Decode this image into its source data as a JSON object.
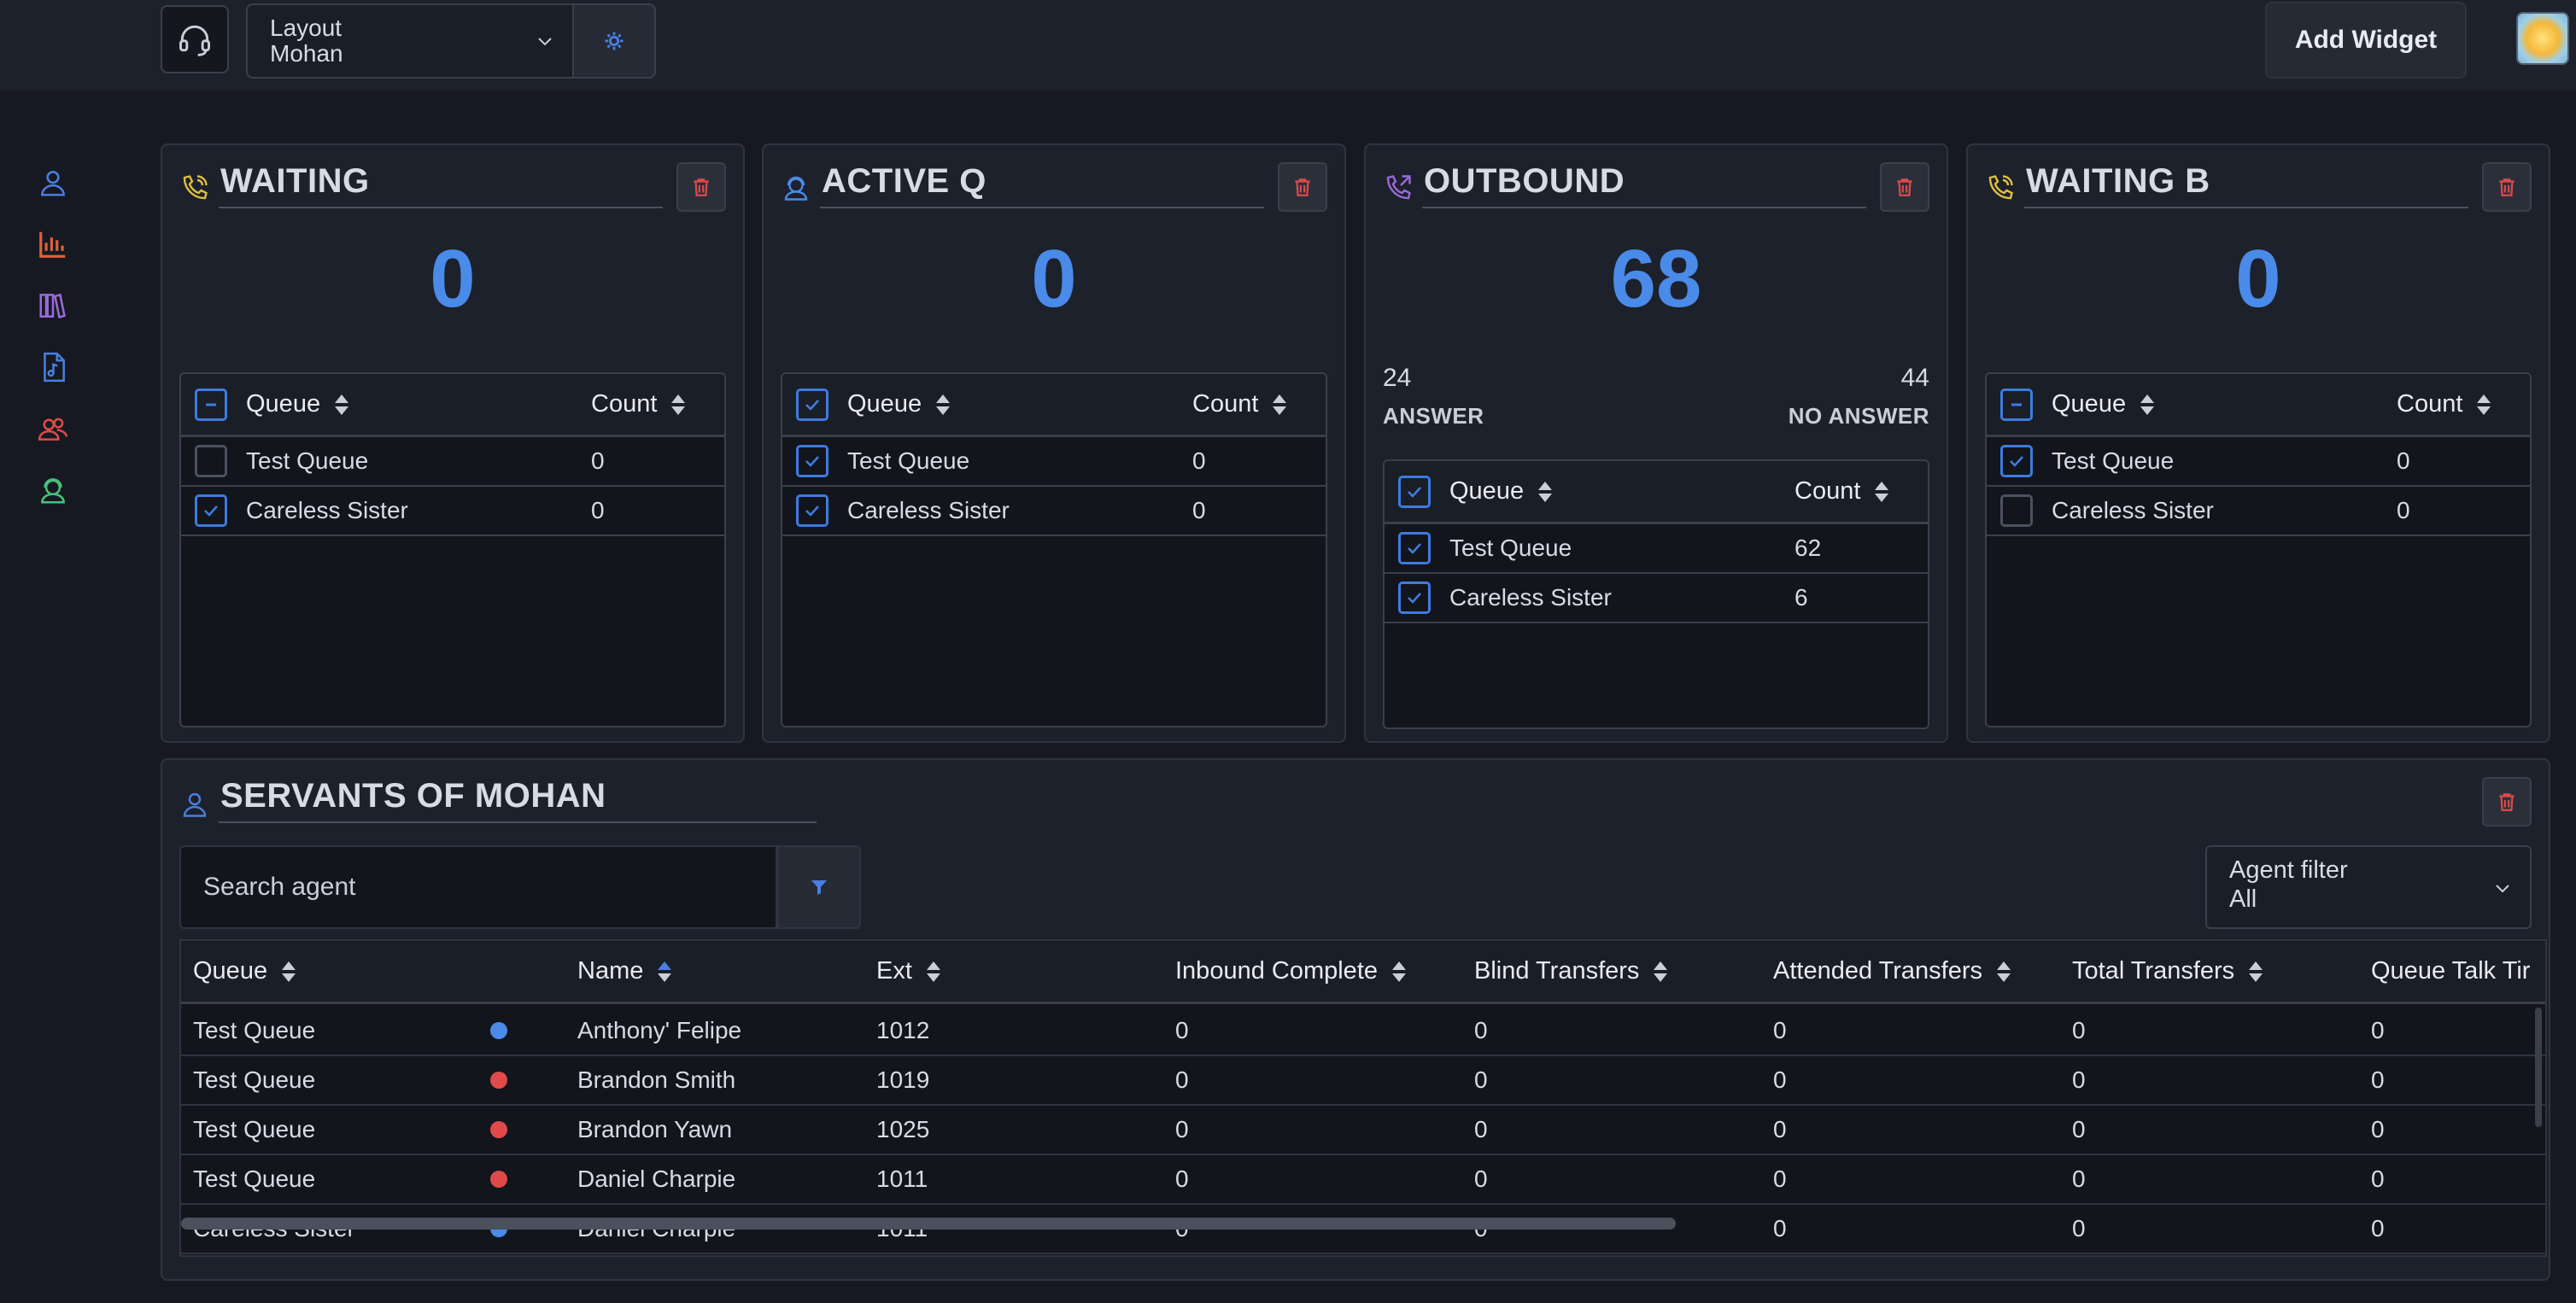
{
  "topbar": {
    "layout_label": "Layout",
    "layout_value": "Mohan",
    "add_widget_label": "Add Widget"
  },
  "sidebar": {
    "items": [
      {
        "icon": "user-icon",
        "color": "#4a7fe0"
      },
      {
        "icon": "bar-chart-icon",
        "color": "#e0603a"
      },
      {
        "icon": "books-icon",
        "color": "#9a6ad8"
      },
      {
        "icon": "music-file-icon",
        "color": "#4a7fe0"
      },
      {
        "icon": "users-icon",
        "color": "#e04a4a"
      },
      {
        "icon": "agent-headset-icon",
        "color": "#4ac07a"
      }
    ]
  },
  "widgets": [
    {
      "title": "WAITING",
      "icon": "phone-ringing-icon",
      "icon_color": "#e0c040",
      "value": "0",
      "table": {
        "col_queue": "Queue",
        "col_count": "Count",
        "rows": [
          {
            "queue": "Test Queue",
            "count": "0",
            "checked": false
          },
          {
            "queue": "Careless Sister",
            "count": "0",
            "checked": true
          }
        ]
      }
    },
    {
      "title": "ACTIVE Q",
      "icon": "agent-headset-icon",
      "icon_color": "#4a8ae8",
      "value": "0",
      "table": {
        "col_queue": "Queue",
        "col_count": "Count",
        "rows": [
          {
            "queue": "Test Queue",
            "count": "0",
            "checked": true
          },
          {
            "queue": "Careless Sister",
            "count": "0",
            "checked": true
          }
        ]
      }
    },
    {
      "title": "OUTBOUND",
      "icon": "phone-outgoing-icon",
      "icon_color": "#9a6ad8",
      "value": "68",
      "answer_value": "24",
      "answer_label": "ANSWER",
      "no_answer_value": "44",
      "no_answer_label": "NO ANSWER",
      "table": {
        "col_queue": "Queue",
        "col_count": "Count",
        "rows": [
          {
            "queue": "Test Queue",
            "count": "62",
            "checked": true
          },
          {
            "queue": "Careless Sister",
            "count": "6",
            "checked": true
          }
        ]
      }
    },
    {
      "title": "WAITING B",
      "icon": "phone-ringing-icon",
      "icon_color": "#e0c040",
      "value": "0",
      "table": {
        "col_queue": "Queue",
        "col_count": "Count",
        "rows": [
          {
            "queue": "Test Queue",
            "count": "0",
            "checked": true
          },
          {
            "queue": "Careless Sister",
            "count": "0",
            "checked": false
          }
        ]
      }
    }
  ],
  "agents": {
    "title": "SERVANTS OF MOHAN",
    "search_placeholder": "Search agent",
    "filter_label": "Agent filter",
    "filter_value": "All",
    "columns": [
      "Queue",
      "Name",
      "Ext",
      "Inbound Complete",
      "Blind Transfers",
      "Attended Transfers",
      "Total Transfers",
      "Queue Talk Tir"
    ],
    "rows": [
      {
        "queue": "Test Queue",
        "status": "blue",
        "name": "Anthony' Felipe",
        "ext": "1012",
        "inbound": "0",
        "blind": "0",
        "attended": "0",
        "total": "0",
        "talk": "0"
      },
      {
        "queue": "Test Queue",
        "status": "red",
        "name": "Brandon Smith",
        "ext": "1019",
        "inbound": "0",
        "blind": "0",
        "attended": "0",
        "total": "0",
        "talk": "0"
      },
      {
        "queue": "Test Queue",
        "status": "red",
        "name": "Brandon Yawn",
        "ext": "1025",
        "inbound": "0",
        "blind": "0",
        "attended": "0",
        "total": "0",
        "talk": "0"
      },
      {
        "queue": "Test Queue",
        "status": "red",
        "name": "Daniel Charpie",
        "ext": "1011",
        "inbound": "0",
        "blind": "0",
        "attended": "0",
        "total": "0",
        "talk": "0"
      },
      {
        "queue": "Careless Sister",
        "status": "blue",
        "name": "Daniel Charpie",
        "ext": "1011",
        "inbound": "0",
        "blind": "0",
        "attended": "0",
        "total": "0",
        "talk": "0"
      }
    ]
  },
  "colors": {
    "accent": "#4a8ae8",
    "status_blue": "#4a8ae8",
    "status_red": "#e04a4a",
    "trash": "#e04a4a"
  }
}
